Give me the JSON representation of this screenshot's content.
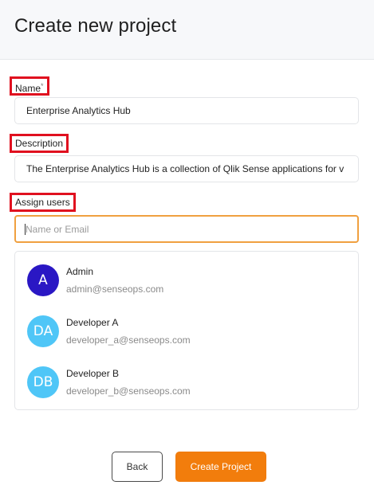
{
  "header": {
    "title": "Create new project"
  },
  "form": {
    "name": {
      "label": "Name",
      "required_mark": "*",
      "value": "Enterprise Analytics Hub"
    },
    "description": {
      "label": "Description",
      "value": "The Enterprise Analytics Hub is a collection of Qlik Sense applications for v"
    },
    "assign_users": {
      "label": "Assign users",
      "placeholder": "Name or Email",
      "value": ""
    }
  },
  "users": [
    {
      "initials": "A",
      "name": "Admin",
      "email": "admin@senseops.com",
      "avatar_color": "#2a17c4"
    },
    {
      "initials": "DA",
      "name": "Developer A",
      "email": "developer_a@senseops.com",
      "avatar_color": "#4fc6f7"
    },
    {
      "initials": "DB",
      "name": "Developer B",
      "email": "developer_b@senseops.com",
      "avatar_color": "#4fc6f7"
    }
  ],
  "actions": {
    "back_label": "Back",
    "create_label": "Create Project"
  },
  "colors": {
    "accent": "#f27d0c",
    "focus_border": "#f0a040",
    "highlight_box": "#e0101f"
  }
}
